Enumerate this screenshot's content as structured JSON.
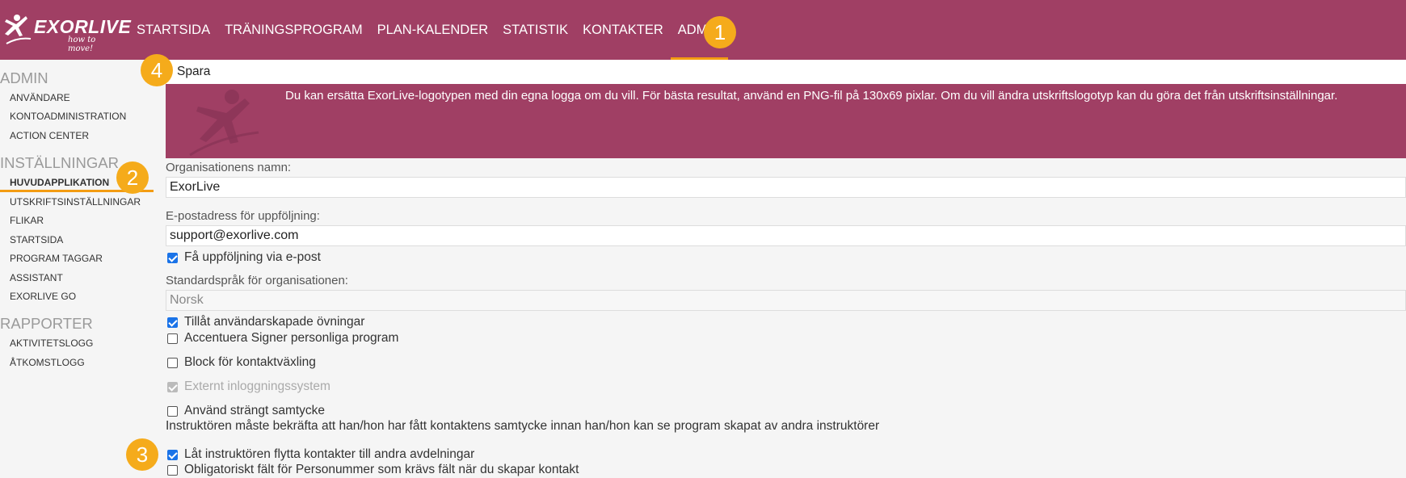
{
  "app": {
    "logo_text": "EXORLIVE",
    "logo_tagline": "how to move!"
  },
  "nav": [
    {
      "label": "STARTSIDA",
      "active": false
    },
    {
      "label": "TRÄNINGSPROGRAM",
      "active": false
    },
    {
      "label": "PLAN-KALENDER",
      "active": false
    },
    {
      "label": "STATISTIK",
      "active": false
    },
    {
      "label": "KONTAKTER",
      "active": false
    },
    {
      "label": "ADMIN",
      "active": true
    }
  ],
  "badges": [
    "1",
    "2",
    "3",
    "4"
  ],
  "sidebar": {
    "admin_heading": "ADMIN",
    "admin_items": [
      "ANVÄNDARE",
      "KONTOADMINISTRATION",
      "ACTION CENTER"
    ],
    "settings_heading": "INSTÄLLNINGAR",
    "settings_items": [
      "HUVUDAPPLIKATION",
      "UTSKRIFTSINSTÄLLNINGAR",
      "FLIKAR",
      "STARTSIDA",
      "PROGRAM TAGGAR",
      "ASSISTANT",
      "EXORLIVE GO"
    ],
    "reports_heading": "RAPPORTER",
    "reports_items": [
      "AKTIVITETSLOGG",
      "ÅTKOMSTLOGG"
    ]
  },
  "toolbar": {
    "save_label": "Spara"
  },
  "banner": {
    "text": "Du kan ersätta ExorLive-logotypen med din egna logga om du vill. För bästa resultat, använd en PNG-fil på 130x69 pixlar. Om du vill ändra utskriftslogotyp kan du göra det från utskriftsinställningar."
  },
  "form": {
    "org_name_label": "Organisationens namn:",
    "org_name_value": "ExorLive",
    "email_label": "E-postadress för uppföljning:",
    "email_value": "support@exorlive.com",
    "email_followup_check": "Få uppföljning via e-post",
    "language_label": "Standardspråk för organisationen:",
    "language_value": "Norsk",
    "allow_user_exercises": "Tillåt användarskapade övningar",
    "accent_signed": "Accentuera Signer personliga program",
    "block_contact_switch": "Block för kontaktväxling",
    "external_login": "Externt inloggningssystem",
    "strict_consent": "Använd strängt samtycke",
    "strict_consent_hint": "Instruktören måste bekräfta att han/hon har fått kontaktens samtycke innan han/hon kan se program skapat av andra instruktörer",
    "move_contacts": "Låt instruktören flytta kontakter till andra avdelningar",
    "ssn_required": "Obligatoriskt fält för Personummer som krävs fält när du skapar kontakt"
  },
  "colors": {
    "brand": "#a03f64",
    "accent": "#f39c12",
    "badge": "#f5ab1b",
    "checkbox": "#1a73e8"
  }
}
